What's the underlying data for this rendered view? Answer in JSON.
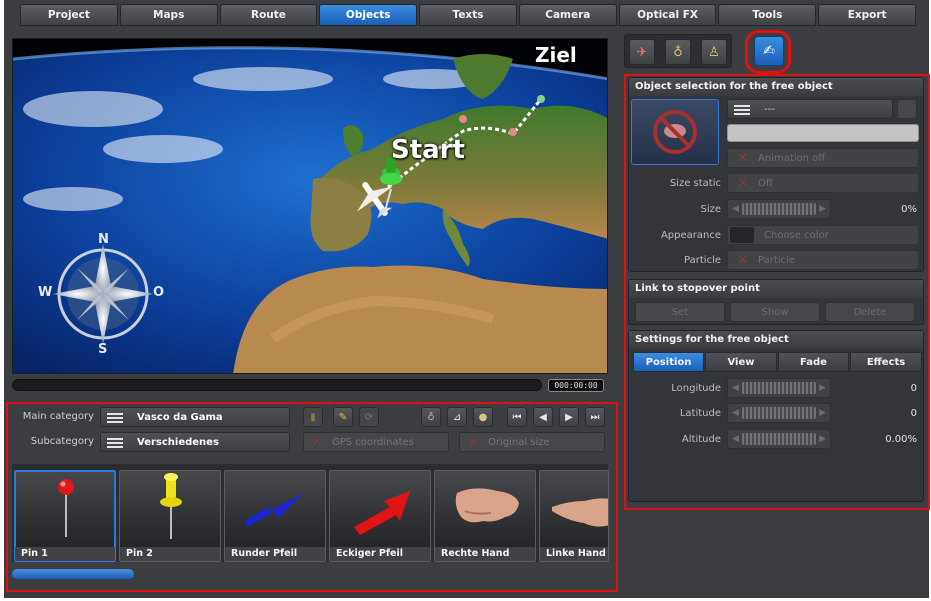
{
  "tabs": [
    {
      "label": "Project",
      "active": false
    },
    {
      "label": "Maps",
      "active": false
    },
    {
      "label": "Route",
      "active": false
    },
    {
      "label": "Objects",
      "active": true
    },
    {
      "label": "Texts",
      "active": false
    },
    {
      "label": "Camera",
      "active": false
    },
    {
      "label": "Optical FX",
      "active": false
    },
    {
      "label": "Tools",
      "active": false
    },
    {
      "label": "Export",
      "active": false
    }
  ],
  "map": {
    "label_start": "Start",
    "label_ziel": "Ziel",
    "compass": {
      "n": "N",
      "s": "S",
      "w": "W",
      "o": "O"
    }
  },
  "timeline": {
    "timecode": "000:00:00",
    "progress": 0
  },
  "category": {
    "main_label": "Main category",
    "main_value": "Vasco da Gama",
    "sub_label": "Subcategory",
    "sub_value": "Verschiedenes",
    "gps_label": "GPS coordinates",
    "original_size_label": "Original size"
  },
  "gallery": [
    {
      "label": "Pin 1",
      "icon": "red-pin-icon",
      "selected": true
    },
    {
      "label": "Pin 2",
      "icon": "yellow-pin-icon",
      "selected": false
    },
    {
      "label": "Runder Pfeil",
      "icon": "blue-arrow-icon",
      "selected": false
    },
    {
      "label": "Eckiger Pfeil",
      "icon": "red-arrow-icon",
      "selected": false
    },
    {
      "label": "Rechte Hand",
      "icon": "right-hand-icon",
      "selected": false
    },
    {
      "label": "Linke Hand",
      "icon": "left-hand-icon",
      "selected": false
    }
  ],
  "object_selection": {
    "title": "Object selection for the free object",
    "object_value": "---",
    "animation": "Animation off",
    "size_static_label": "Size static",
    "size_static_value": "Off",
    "size_label": "Size",
    "size_value": "0%",
    "appearance_label": "Appearance",
    "appearance_value": "Choose color",
    "particle_label": "Particle",
    "particle_value": "Particle"
  },
  "stopover": {
    "title": "Link to stopover point",
    "set": "Set",
    "show": "Show",
    "delete": "Delete"
  },
  "settings": {
    "title": "Settings for the free object",
    "tabs": [
      {
        "label": "Position",
        "active": true
      },
      {
        "label": "View",
        "active": false
      },
      {
        "label": "Fade",
        "active": false
      },
      {
        "label": "Effects",
        "active": false
      }
    ],
    "longitude_label": "Longitude",
    "longitude_value": "0",
    "latitude_label": "Latitude",
    "latitude_value": "0",
    "altitude_label": "Altitude",
    "altitude_value": "0.00%"
  },
  "colors": {
    "accent": "#2e7ad8",
    "highlight": "#e01010",
    "panel": "#3c3d40"
  }
}
